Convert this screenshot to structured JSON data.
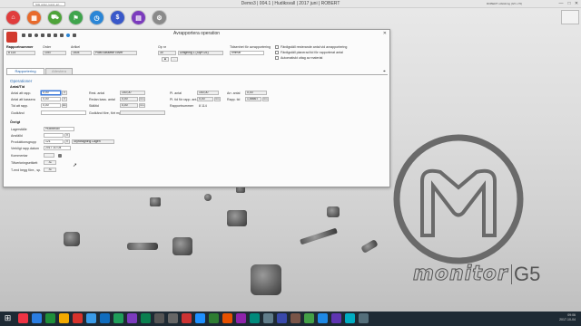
{
  "os": {
    "search_placeholder": "Sök order, kund, art...",
    "window_title": "Demo3 | 004.1 | Hudiksvall | 2017 juni | ROBERT",
    "user_info": "ROBERT utbildning (G5 v.70)",
    "minimize": "—",
    "maximize": "□",
    "close": "✕"
  },
  "quicklaunch": [
    {
      "name": "home",
      "color": "#e03d3d",
      "glyph": "⌂"
    },
    {
      "name": "orders",
      "color": "#e86a2c",
      "glyph": "▦"
    },
    {
      "name": "purchase",
      "color": "#4ea33a",
      "glyph": "⛟"
    },
    {
      "name": "production",
      "color": "#3fa44d",
      "glyph": "⚑"
    },
    {
      "name": "warehouse",
      "color": "#2b86d6",
      "glyph": "◷"
    },
    {
      "name": "finance",
      "color": "#3a59c9",
      "glyph": "$"
    },
    {
      "name": "calculator",
      "color": "#7b3bbd",
      "glyph": "▤"
    },
    {
      "name": "settings",
      "color": "#8a8a8a",
      "glyph": "⚙"
    }
  ],
  "dialog": {
    "title": "Avrapportera operation",
    "close": "✕",
    "header": {
      "rapportnummer_label": "Rapportnummer",
      "rapportnummer": "8 114",
      "order_label": "Order",
      "order": "1057",
      "artikel_label": "Artikel",
      "artikel": "1604",
      "artikel_namn": "Plast cassette cover",
      "op_label": "Op nr",
      "op": "30",
      "op_namn": "Dragning 1 (Styr<25)",
      "tidsenhet_label": "Tidsenhet för avrapportering",
      "tidsenhet": "timmar",
      "chk1": "Färdigställ resterande antal vid avrapportering",
      "chk2": "Färdigställ planerad tid för rapporterat antal",
      "chk3": "Automatiskt uttag av material"
    },
    "tabs": [
      "Rapportering",
      "Attestera"
    ],
    "operationer_title": "Operationer",
    "antal_tid_title": "Antal/Tid",
    "rows": {
      "antal_rapp_label": "Antal att rapp.",
      "antal_rapp": "0,00",
      "antal_kasser_label": "Antal att kassera",
      "antal_kasser": "0,00",
      "tid_rapp_label": "Tid att rapp.",
      "tid_rapp": "0,00",
      "godkand_label": "Godkänd",
      "godkand": "",
      "rest_antal_label": "Rest. antal",
      "rest_antal": "150,00",
      "rest_kass_label": "Redan kass. antal",
      "rest_kass": "0,00",
      "stalltid_label": "Ställtid",
      "stalltid": "0,00",
      "godkand_fmg_label": "Godkänd före, fört mg. sp.",
      "godkand_fmg": "",
      "pl_antal_label": "Pl. antal",
      "pl_antal": "150,00",
      "pl_tid_label": "Pl. tid för rapp. ant.",
      "pl_tid": "0,00",
      "rapp_nr_label": "Rapportnummer",
      "rapp_nr": "8 114",
      "arb_antal_label": "Arr. antal",
      "arb_antal": "0,00",
      "rapp_tid_label": "Rapp. tid",
      "rapp_tid": "1,66667",
      "unit": "tim"
    },
    "ovrigt_title": "Övrigt",
    "ovrigt": {
      "lagerstalle_label": "Lagerställe",
      "lagerstalle": "Hudiksvall",
      "anstalld_label": "Anställd",
      "anstalld": "",
      "produktionsgrupp_label": "Produktionsgrupp",
      "produktionsgrupp": "121",
      "produktionsgrupp_namn": "Styrdragning Lagen",
      "verkligt_datum_label": "Verkligt rapp.datum",
      "verkligt_datum": "2017-10-04",
      "kommentar_label": "Kommentar",
      "kommentar": "",
      "tillverkningslabel_label": "Tillverkningsetikett",
      "tillverkningslabel": "Ja",
      "tbegg_label": "T-end begg före., sp.",
      "tbegg": "Ja"
    }
  },
  "brand": {
    "name": "monitor",
    "version": "G5"
  },
  "clock": {
    "time": "09:06",
    "date": "2017-10-04"
  }
}
